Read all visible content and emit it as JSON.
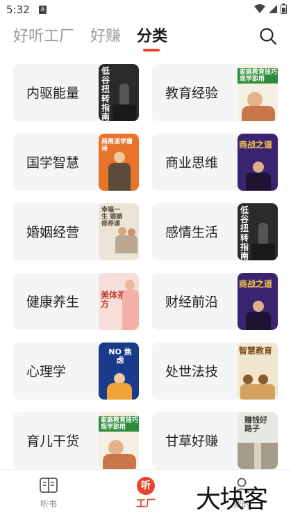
{
  "status_bar": {
    "time": "5:32",
    "notif": "A"
  },
  "top_tabs": [
    {
      "label": "好听工厂",
      "active": false
    },
    {
      "label": "好赚",
      "active": false
    },
    {
      "label": "分类",
      "active": true
    }
  ],
  "categories": [
    {
      "label": "内驱能量",
      "thumb": {
        "theme": "dark",
        "text": "低谷扭转指南",
        "bg": "#2b2b2b",
        "fg": "#ffffff"
      }
    },
    {
      "label": "教育经验",
      "thumb": {
        "theme": "green",
        "text": "家庭教育技巧 现学即用",
        "bg": "#f5efe1",
        "fg": "#1f6b2a"
      }
    },
    {
      "label": "国学智慧",
      "thumb": {
        "theme": "orange",
        "text": "两周速学唐诗",
        "bg": "#e8732b",
        "fg": "#ffffff"
      }
    },
    {
      "label": "商业思维",
      "thumb": {
        "theme": "purple",
        "text": "商战之道",
        "bg": "#3a2470",
        "fg": "#f7c94a"
      }
    },
    {
      "label": "婚姻经营",
      "thumb": {
        "theme": "beige",
        "text": "幸福一生 婚姻修养课",
        "bg": "#ece4d6",
        "fg": "#5a4a3a"
      }
    },
    {
      "label": "感情生活",
      "thumb": {
        "theme": "dark",
        "text": "低谷扭转指南",
        "bg": "#2b2b2b",
        "fg": "#ffffff"
      }
    },
    {
      "label": "健康养生",
      "thumb": {
        "theme": "pink",
        "text": "美体茶方",
        "bg": "#f6dedb",
        "fg": "#c0392b"
      }
    },
    {
      "label": "财经前沿",
      "thumb": {
        "theme": "purple",
        "text": "商战之道",
        "bg": "#3a2470",
        "fg": "#f7c94a"
      }
    },
    {
      "label": "心理学",
      "thumb": {
        "theme": "blue",
        "text": "NO 焦虑",
        "bg": "#1a3a8a",
        "fg": "#ffffff"
      }
    },
    {
      "label": "处世法技",
      "thumb": {
        "theme": "cream",
        "text": "智慧教育",
        "bg": "#f3e6cf",
        "fg": "#7a4a1a"
      }
    },
    {
      "label": "育儿干货",
      "thumb": {
        "theme": "green",
        "text": "家庭教育技巧 现学即用",
        "bg": "#f5efe1",
        "fg": "#1f6b2a"
      }
    },
    {
      "label": "甘草好赚",
      "thumb": {
        "theme": "gray",
        "text": "赚钱好路子",
        "bg": "#e9e7e2",
        "fg": "#3a3a3a"
      }
    }
  ],
  "bottom_nav": [
    {
      "label": "听书",
      "active": false,
      "icon": "book-icon"
    },
    {
      "label": "工厂",
      "active": true,
      "icon": "listen-factory-icon",
      "badge": "听"
    },
    {
      "label": "我的",
      "active": false,
      "icon": "user-icon"
    }
  ],
  "watermark": "大块客",
  "colors": {
    "accent": "#e8432e",
    "card_bg": "#f4f5f7",
    "tab_inactive": "#9a9a9a"
  }
}
